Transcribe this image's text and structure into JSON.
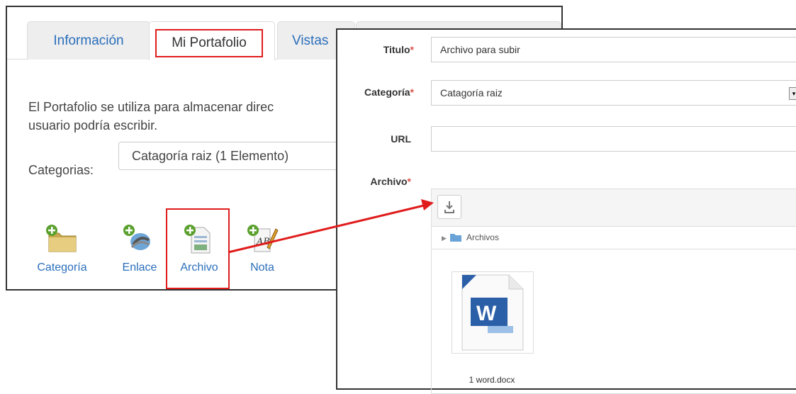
{
  "tabs": [
    {
      "label": "Información"
    },
    {
      "label": "Mi Portafolio"
    },
    {
      "label": "Vistas"
    }
  ],
  "portfolio": {
    "description_line1": "El Portafolio se utiliza para almacenar direc",
    "description_line2": "usuario podría escribir.",
    "categories_label": "Categorias:",
    "categories_value": "Catagoría raiz (1 Elemento)"
  },
  "actions": [
    {
      "label": "Categoría",
      "icon": "add-folder-icon"
    },
    {
      "label": "Enlace",
      "icon": "add-link-icon"
    },
    {
      "label": "Archivo",
      "icon": "add-file-icon"
    },
    {
      "label": "Nota",
      "icon": "add-note-icon"
    }
  ],
  "form": {
    "titulo_label": "Titulo",
    "titulo_value": "Archivo para subir",
    "categoria_label": "Categoría",
    "categoria_value": "Catagoría raiz",
    "url_label": "URL",
    "url_value": "",
    "archivo_label": "Archivo",
    "required_mark": "*"
  },
  "uploader": {
    "folder_label": "Archivos",
    "file_name": "1 word.docx",
    "file_icon": "word-document-icon"
  },
  "colors": {
    "link": "#2a6ebb",
    "highlight": "#e01c1c",
    "required": "#d9534f"
  }
}
